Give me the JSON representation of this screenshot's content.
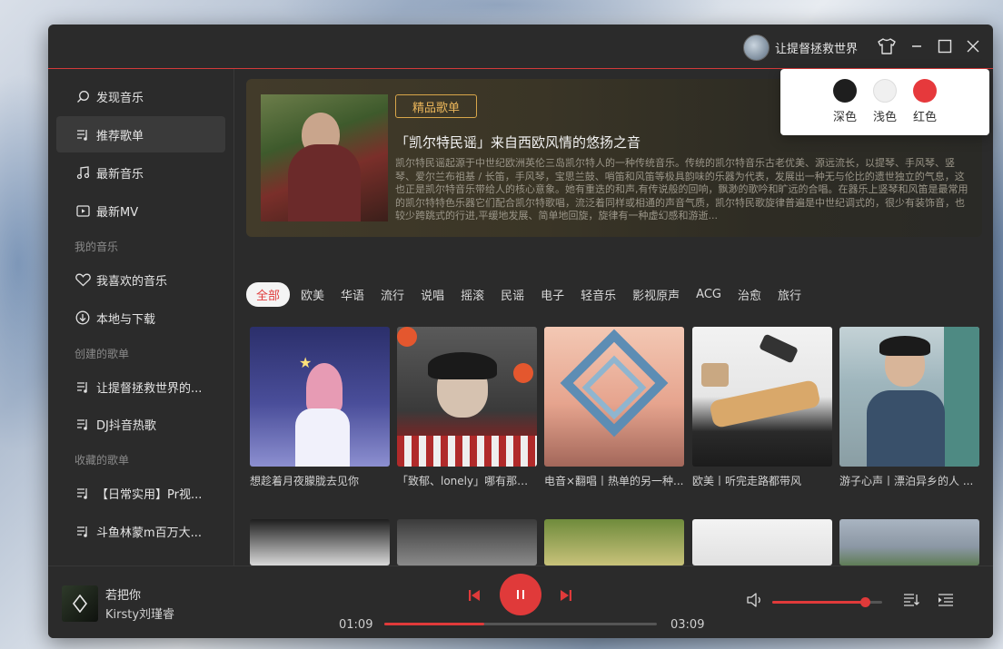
{
  "colors": {
    "accent": "#e03a3a",
    "window_bg": "#2b2b2b",
    "badge_gold": "#e9b55a"
  },
  "titlebar": {
    "username": "让提督拯救世界",
    "icons": [
      "skin-icon",
      "minimize-icon",
      "maximize-icon",
      "close-icon"
    ]
  },
  "sidebar": {
    "items": [
      {
        "label": "发现音乐",
        "icon": "search-icon"
      },
      {
        "label": "推荐歌单",
        "icon": "playlist-icon"
      },
      {
        "label": "最新音乐",
        "icon": "music-note-icon"
      },
      {
        "label": "最新MV",
        "icon": "video-icon"
      }
    ],
    "my_music_label": "我的音乐",
    "my_music": [
      {
        "label": "我喜欢的音乐",
        "icon": "heart-icon"
      },
      {
        "label": "本地与下载",
        "icon": "download-icon"
      }
    ],
    "created_label": "创建的歌单",
    "created": [
      {
        "label": "让提督拯救世界的...",
        "icon": "playlist-icon"
      },
      {
        "label": "DJ抖音热歌",
        "icon": "playlist-icon"
      }
    ],
    "collected_label": "收藏的歌单",
    "collected": [
      {
        "label": "【日常实用】Pr视...",
        "icon": "playlist-icon"
      },
      {
        "label": "斗鱼林蒙m百万大...",
        "icon": "playlist-icon"
      }
    ]
  },
  "banner": {
    "badge": "精品歌单",
    "title": "「凯尔特民谣」来自西欧风情的悠扬之音",
    "description": "凯尔特民谣起源于中世纪欧洲英伦三岛凯尔特人的一种传统音乐。传统的凯尔特音乐古老优美、源远流长，以提琴、手风琴、竖琴、爱尔兰布祖基 / 长笛，手风琴，宝思兰鼓、哨笛和风笛等极具韵味的乐器为代表，发展出一种无与伦比的遗世独立的气息，这也正是凯尔特音乐带给人的核心意象。她有重迭的和声,有传说般的回响，飘渺的歌吟和旷远的合唱。在器乐上竖琴和风笛是最常用的凯尔特特色乐器它们配合凯尔特歌唱，流泛着同样或相通的声音气质，凯尔特民歌旋律普遍是中世纪调式的，很少有装饰音，也较少跨跳式的行进,平缓地发展、简单地回旋，旋律有一种虚幻感和游逝..."
  },
  "tags": [
    "全部",
    "欧美",
    "华语",
    "流行",
    "说唱",
    "摇滚",
    "民谣",
    "电子",
    "轻音乐",
    "影视原声",
    "ACG",
    "治愈",
    "旅行"
  ],
  "playlists_row1": [
    {
      "title": "想趁着月夜朦胧去见你"
    },
    {
      "title": "「致郁、lonely」哪有那么多..."
    },
    {
      "title": "电音×翻唱丨热单的另一种..."
    },
    {
      "title": "欧美丨听完走路都带风"
    },
    {
      "title": "游子心声丨漂泊异乡的人 ..."
    }
  ],
  "player": {
    "song_title": "若把你",
    "artist": "Kirsty刘瑾睿",
    "current_time": "01:09",
    "total_time": "03:09",
    "progress": 0.365,
    "volume": 0.84,
    "state": "playing"
  },
  "skin_popup": {
    "options": [
      {
        "label": "深色",
        "color": "#1e1e1e"
      },
      {
        "label": "浅色",
        "color": "#f0f0f0"
      },
      {
        "label": "红色",
        "color": "#e6393c"
      }
    ]
  }
}
